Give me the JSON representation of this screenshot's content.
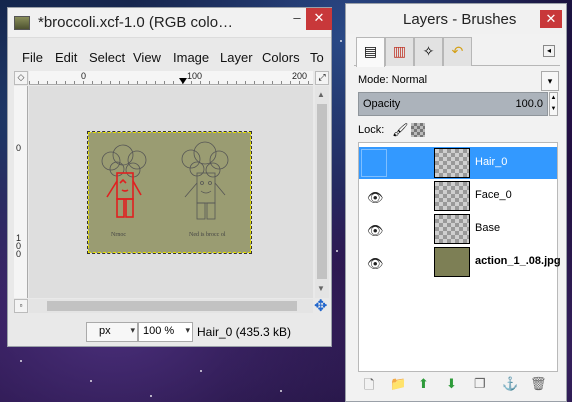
{
  "image_window": {
    "title": "*broccoli.xcf-1.0 (RGB colo…",
    "minimize": "–",
    "close": "✕",
    "menu": [
      "File",
      "Edit",
      "Select",
      "View",
      "Image",
      "Layer",
      "Colors",
      "To"
    ],
    "ruler_ticks": [
      "0",
      "100",
      "200"
    ],
    "vruler_ticks": [
      "0",
      "1\n0\n0"
    ],
    "unit": "px",
    "zoom": "100 %",
    "status": "Hair_0 (435.3 kB)",
    "image_labels": [
      "Nrnoc",
      "Ned is brocc ol"
    ]
  },
  "layers_window": {
    "title": "Layers - Brushes",
    "close": "✕",
    "mode_label": "Mode: Normal",
    "opacity_label": "Opacity",
    "opacity_value": "100.0",
    "lock_label": "Lock:",
    "layers": [
      {
        "name": "Hair_0",
        "visible": false,
        "selected": true,
        "bold": false
      },
      {
        "name": "Face_0",
        "visible": true,
        "selected": false,
        "bold": false
      },
      {
        "name": "Base",
        "visible": true,
        "selected": false,
        "bold": false
      },
      {
        "name": "action_1_.08.jpg",
        "visible": true,
        "selected": false,
        "bold": true
      }
    ]
  },
  "icons": {
    "eye": "eye-icon",
    "paintbrush": "paintbrush-icon",
    "alpha": "alpha-lock-icon"
  },
  "colors": {
    "selection": "#3399ff",
    "close_button": "#c8383a",
    "opacity_bar": "#acb3bb"
  }
}
